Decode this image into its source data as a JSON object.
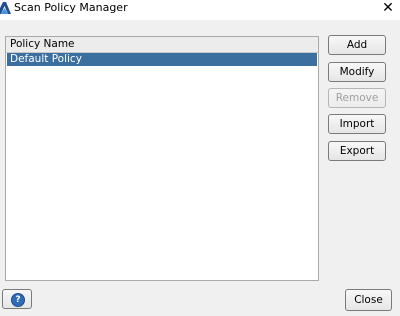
{
  "window": {
    "title": "Scan Policy Manager",
    "close_glyph": "✕"
  },
  "list": {
    "header": "Policy Name",
    "items": [
      {
        "label": "Default Policy",
        "selected": true
      }
    ]
  },
  "buttons": {
    "add": "Add",
    "modify": "Modify",
    "remove": "Remove",
    "import": "Import",
    "export": "Export",
    "close": "Close",
    "help_glyph": "?"
  },
  "colors": {
    "selection": "#3b6f9f",
    "help_icon": "#2f6cb5"
  }
}
